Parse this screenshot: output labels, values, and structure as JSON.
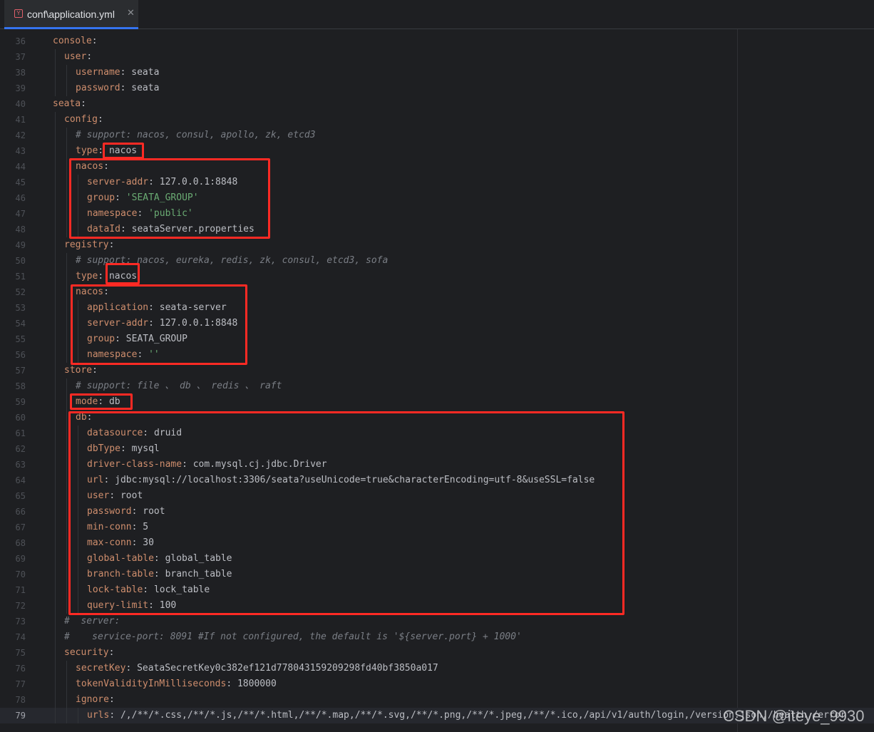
{
  "tab": {
    "title": "conf\\application.yml",
    "icon": "yaml-file-icon",
    "close_label": "✕"
  },
  "editor": {
    "current_line": 79,
    "lines": [
      {
        "no": "36",
        "indent": 0,
        "key": "console",
        "sep": ":",
        "value": "",
        "type": "p"
      },
      {
        "no": "37",
        "indent": 1,
        "key": "user",
        "sep": ":",
        "value": "",
        "type": "p"
      },
      {
        "no": "38",
        "indent": 2,
        "key": "username",
        "sep": ": ",
        "value": "seata",
        "type": "p"
      },
      {
        "no": "39",
        "indent": 2,
        "key": "password",
        "sep": ": ",
        "value": "seata",
        "type": "p"
      },
      {
        "no": "40",
        "indent": 0,
        "key": "seata",
        "sep": ":",
        "value": "",
        "type": "p"
      },
      {
        "no": "41",
        "indent": 1,
        "key": "config",
        "sep": ":",
        "value": "",
        "type": "p"
      },
      {
        "no": "42",
        "indent": 2,
        "comment": "# support: nacos, consul, apollo, zk, etcd3"
      },
      {
        "no": "43",
        "indent": 2,
        "key": "type",
        "sep": ": ",
        "value": "nacos",
        "type": "p"
      },
      {
        "no": "44",
        "indent": 2,
        "key": "nacos",
        "sep": ":",
        "value": "",
        "type": "p"
      },
      {
        "no": "45",
        "indent": 3,
        "key": "server-addr",
        "sep": ": ",
        "value": "127.0.0.1:8848",
        "type": "p"
      },
      {
        "no": "46",
        "indent": 3,
        "key": "group",
        "sep": ": ",
        "value": "'SEATA_GROUP'",
        "type": "s"
      },
      {
        "no": "47",
        "indent": 3,
        "key": "namespace",
        "sep": ": ",
        "value": "'public'",
        "type": "s"
      },
      {
        "no": "48",
        "indent": 3,
        "key": "dataId",
        "sep": ": ",
        "value": "seataServer.properties",
        "type": "p"
      },
      {
        "no": "49",
        "indent": 1,
        "key": "registry",
        "sep": ":",
        "value": "",
        "type": "p"
      },
      {
        "no": "50",
        "indent": 2,
        "comment": "# support: nacos, eureka, redis, zk, consul, etcd3, sofa"
      },
      {
        "no": "51",
        "indent": 2,
        "key": "type",
        "sep": ": ",
        "value": "nacos",
        "type": "p"
      },
      {
        "no": "52",
        "indent": 2,
        "key": "nacos",
        "sep": ":",
        "value": "",
        "type": "p"
      },
      {
        "no": "53",
        "indent": 3,
        "key": "application",
        "sep": ": ",
        "value": "seata-server",
        "type": "p"
      },
      {
        "no": "54",
        "indent": 3,
        "key": "server-addr",
        "sep": ": ",
        "value": "127.0.0.1:8848",
        "type": "p"
      },
      {
        "no": "55",
        "indent": 3,
        "key": "group",
        "sep": ": ",
        "value": "SEATA_GROUP",
        "type": "p"
      },
      {
        "no": "56",
        "indent": 3,
        "key": "namespace",
        "sep": ": ",
        "value": "''",
        "type": "s"
      },
      {
        "no": "57",
        "indent": 1,
        "key": "store",
        "sep": ":",
        "value": "",
        "type": "p"
      },
      {
        "no": "58",
        "indent": 2,
        "comment": "# support: file 、 db 、 redis 、 raft"
      },
      {
        "no": "59",
        "indent": 2,
        "key": "mode",
        "sep": ": ",
        "value": "db",
        "type": "p"
      },
      {
        "no": "60",
        "indent": 2,
        "key": "db",
        "sep": ":",
        "value": "",
        "type": "p"
      },
      {
        "no": "61",
        "indent": 3,
        "key": "datasource",
        "sep": ": ",
        "value": "druid",
        "type": "p"
      },
      {
        "no": "62",
        "indent": 3,
        "key": "dbType",
        "sep": ": ",
        "value": "mysql",
        "type": "p"
      },
      {
        "no": "63",
        "indent": 3,
        "key": "driver-class-name",
        "sep": ": ",
        "value": "com.mysql.cj.jdbc.Driver",
        "type": "p"
      },
      {
        "no": "64",
        "indent": 3,
        "key": "url",
        "sep": ": ",
        "value": "jdbc:mysql://localhost:3306/seata?useUnicode=true&characterEncoding=utf-8&useSSL=false",
        "type": "p"
      },
      {
        "no": "65",
        "indent": 3,
        "key": "user",
        "sep": ": ",
        "value": "root",
        "type": "p"
      },
      {
        "no": "66",
        "indent": 3,
        "key": "password",
        "sep": ": ",
        "value": "root",
        "type": "p"
      },
      {
        "no": "67",
        "indent": 3,
        "key": "min-conn",
        "sep": ": ",
        "value": "5",
        "type": "p"
      },
      {
        "no": "68",
        "indent": 3,
        "key": "max-conn",
        "sep": ": ",
        "value": "30",
        "type": "p"
      },
      {
        "no": "69",
        "indent": 3,
        "key": "global-table",
        "sep": ": ",
        "value": "global_table",
        "type": "p"
      },
      {
        "no": "70",
        "indent": 3,
        "key": "branch-table",
        "sep": ": ",
        "value": "branch_table",
        "type": "p"
      },
      {
        "no": "71",
        "indent": 3,
        "key": "lock-table",
        "sep": ": ",
        "value": "lock_table",
        "type": "p"
      },
      {
        "no": "72",
        "indent": 3,
        "key": "query-limit",
        "sep": ": ",
        "value": "100",
        "type": "p"
      },
      {
        "no": "73",
        "indent": 1,
        "comment": "#  server:"
      },
      {
        "no": "74",
        "indent": 1,
        "comment": "#    service-port: 8091 #If not configured, the default is '${server.port} + 1000'"
      },
      {
        "no": "75",
        "indent": 1,
        "key": "security",
        "sep": ":",
        "value": "",
        "type": "p"
      },
      {
        "no": "76",
        "indent": 2,
        "key": "secretKey",
        "sep": ": ",
        "value": "SeataSecretKey0c382ef121d778043159209298fd40bf3850a017",
        "type": "p"
      },
      {
        "no": "77",
        "indent": 2,
        "key": "tokenValidityInMilliseconds",
        "sep": ": ",
        "value": "1800000",
        "type": "p"
      },
      {
        "no": "78",
        "indent": 2,
        "key": "ignore",
        "sep": ":",
        "value": "",
        "type": "p"
      },
      {
        "no": "79",
        "indent": 3,
        "key": "urls",
        "sep": ": ",
        "value": "/,/**/*.css,/**/*.js,/**/*.html,/**/*.map,/**/*.svg,/**/*.png,/**/*.jpeg,/**/*.ico,/api/v1/auth/login,/version.json,/health,/error",
        "type": "p"
      }
    ]
  },
  "highlight_color": "#ff2a24",
  "watermark": "CSDN @iteye_9930"
}
